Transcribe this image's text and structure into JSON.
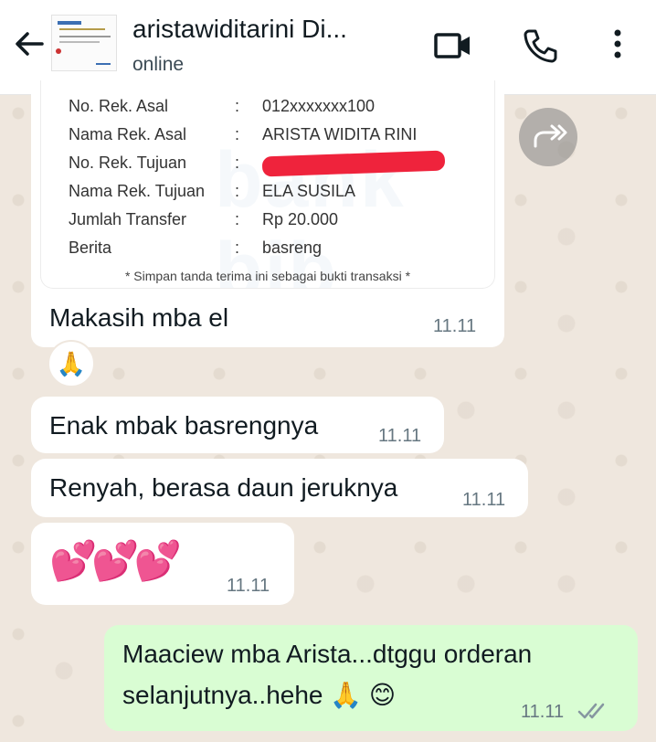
{
  "header": {
    "chat_name": "aristawiditarini Di...",
    "status": "online"
  },
  "receipt": {
    "watermark": "bank bjb",
    "rows": [
      {
        "label": "No. Rek. Asal",
        "value": "012xxxxxxx100"
      },
      {
        "label": "Nama Rek. Asal",
        "value": "ARISTA WIDITA RINI"
      },
      {
        "label": "No. Rek. Tujuan",
        "value": ""
      },
      {
        "label": "Nama Rek. Tujuan",
        "value": "ELA SUSILA"
      },
      {
        "label": "Jumlah Transfer",
        "value": "Rp 20.000"
      },
      {
        "label": "Berita",
        "value": "basreng"
      }
    ],
    "separator": ":",
    "note": "* Simpan tanda terima ini sebagai bukti transaksi *",
    "caption": "Makasih mba el",
    "time": "11.11"
  },
  "reaction": "🙏",
  "messages": [
    {
      "text": "Enak mbak basrengnya",
      "time": "11.11"
    },
    {
      "text": "Renyah, berasa daun jeruknya",
      "time": "11.11"
    },
    {
      "text": "💕💕💕",
      "time": "11.11"
    }
  ],
  "outgoing": {
    "line1": "Maaciew mba Arista...dtggu orderan",
    "line2": "selanjutnya..hehe 🙏 😊",
    "time": "11.11",
    "status": "read"
  },
  "colors": {
    "outgoing_bubble": "#d9fdd3",
    "incoming_bubble": "#ffffff",
    "wallpaper": "#efe7de",
    "redaction": "#ef233c"
  }
}
